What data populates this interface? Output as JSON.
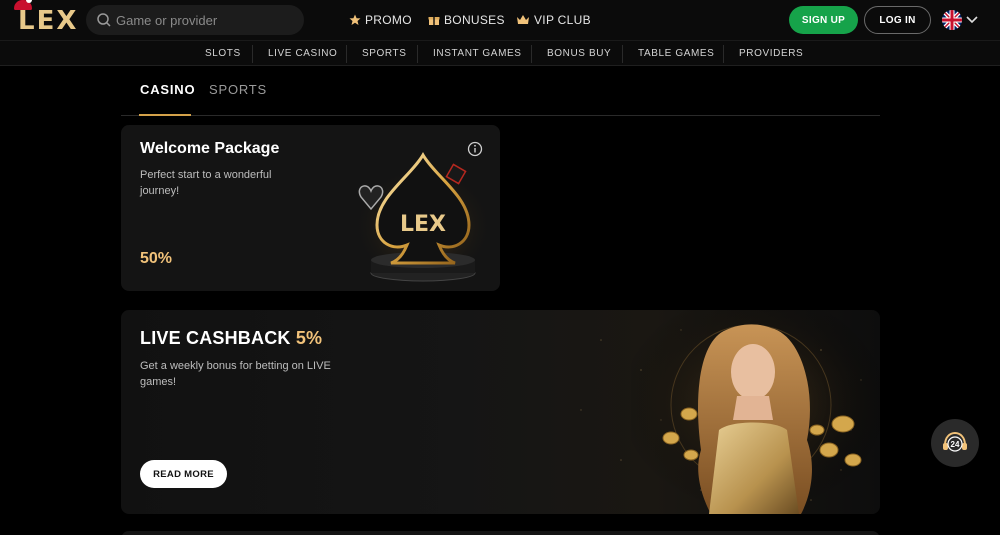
{
  "brand": {
    "logo_text": "LEX"
  },
  "search": {
    "placeholder": "Game or provider"
  },
  "topnav": [
    {
      "label": "PROMO",
      "icon": "star-icon"
    },
    {
      "label": "BONUSES",
      "icon": "gift-icon"
    },
    {
      "label": "VIP CLUB",
      "icon": "crown-icon"
    }
  ],
  "auth": {
    "signup_label": "SIGN UP",
    "login_label": "LOG IN"
  },
  "language": {
    "flag": "uk-flag-icon"
  },
  "subnav": [
    "SLOTS",
    "LIVE CASINO",
    "SPORTS",
    "INSTANT GAMES",
    "BONUS BUY",
    "TABLE GAMES",
    "PROVIDERS"
  ],
  "tabs": [
    {
      "label": "CASINO",
      "active": true
    },
    {
      "label": "SPORTS",
      "active": false
    }
  ],
  "welcome": {
    "title": "Welcome Package",
    "subtitle": "Perfect start to a wonderful journey!",
    "value": "50%",
    "art_text": "LEX"
  },
  "cashback": {
    "title": "LIVE CASHBACK",
    "title_accent": "5%",
    "subtitle": "Get a weekly bonus for betting on LIVE games!",
    "button_label": "READ MORE"
  },
  "support": {
    "label": "24"
  },
  "colors": {
    "accent_gold": "#f1c27a",
    "signup_green": "#16a34a",
    "background": "#000000",
    "card": "#141414"
  }
}
